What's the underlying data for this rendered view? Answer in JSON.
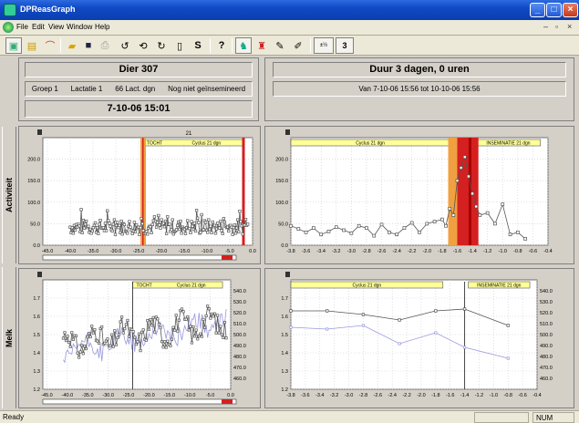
{
  "window": {
    "title": "DPReasGraph"
  },
  "menu": {
    "items": [
      "File",
      "Edit",
      "View",
      "Window",
      "Help"
    ]
  },
  "header": {
    "animal": "Dier 307",
    "info": [
      "Groep 1",
      "Lactatie 1",
      "66 Lact. dgn",
      "Nog niet geïnsemineerd"
    ],
    "datetime": "7-10-06 15:01",
    "duration": "Duur 3 dagen, 0 uren",
    "range": "Van 7-10-06 15:56 tot 10-10-06 15:56"
  },
  "rows": {
    "activity": "Activiteit",
    "milk": "Melk"
  },
  "toolbar": {
    "number_label": "3"
  },
  "status": {
    "left": "Ready",
    "num": "NUM"
  },
  "colors": {
    "series_dark": "#555555",
    "series_light": "#9999dd",
    "event_red": "#d42020",
    "event_orange": "#f0a040",
    "band_yellow": "#ffff99"
  },
  "chart_data": [
    {
      "type": "line",
      "name": "activity-long",
      "xlim": [
        -46,
        0
      ],
      "ylim": [
        0,
        250
      ],
      "xticks": [
        -45,
        -40,
        -35,
        -30,
        -25,
        -20,
        -15,
        -10,
        -5,
        0
      ],
      "xtick_labels": [
        "-45.0",
        "-40.0",
        "-35.0",
        "-30.0",
        "-25.0",
        "-20.0",
        "-15.0",
        "-10.0",
        "-5.0",
        "0.0"
      ],
      "yticks": [
        0,
        50,
        100,
        150,
        200
      ],
      "ytick_labels": [
        "0.0",
        "50.0",
        "100.0",
        "150.0",
        "200.0"
      ],
      "top_label": "21",
      "markers": [
        -24,
        -2
      ],
      "bands": [
        {
          "from": -24,
          "to": -2,
          "labels": [
            "TOCHT",
            "Cyclus 21 dgn"
          ]
        }
      ]
    },
    {
      "type": "line",
      "name": "activity-short",
      "xlim": [
        -3.8,
        -0.4
      ],
      "ylim": [
        0,
        250
      ],
      "xticks": [
        -3.8,
        -3.6,
        -3.4,
        -3.2,
        -3.0,
        -2.8,
        -2.6,
        -2.4,
        -2.2,
        -2.0,
        -1.8,
        -1.6,
        -1.4,
        -1.2,
        -1.0,
        -0.8,
        -0.6,
        -0.4
      ],
      "xtick_labels": [
        "-3.8",
        "-3.6",
        "-3.4",
        "-3.2",
        "-3.0",
        "-2.8",
        "-2.6",
        "-2.4",
        "-2.2",
        "-2.0",
        "-1.8",
        "-1.6",
        "-1.4",
        "-1.2",
        "-1.0",
        "-0.8",
        "-0.6",
        "-0.4"
      ],
      "yticks": [
        0,
        50,
        100,
        150,
        200
      ],
      "ytick_labels": [
        "0.0",
        "50.0",
        "100.0",
        "150.0",
        "200.0"
      ],
      "bands": [
        {
          "from": -3.8,
          "to": -1.7,
          "labels": [
            "Cyclus 21 dgn"
          ]
        },
        {
          "from": -1.35,
          "to": -0.5,
          "labels": [
            "INSEMINATIE 21 dgn"
          ]
        }
      ],
      "series": [
        {
          "x": [
            -3.8,
            -3.7,
            -3.6,
            -3.5,
            -3.4,
            -3.3,
            -3.2,
            -3.1,
            -3.0,
            -2.9,
            -2.8,
            -2.7,
            -2.6,
            -2.5,
            -2.4,
            -2.3,
            -2.2,
            -2.1,
            -2.0,
            -1.9,
            -1.8,
            -1.75,
            -1.7,
            -1.65,
            -1.6,
            -1.55,
            -1.5,
            -1.45,
            -1.4,
            -1.35,
            -1.3,
            -1.2,
            -1.1,
            -1.0,
            -0.9,
            -0.8,
            -0.7
          ],
          "values": [
            45,
            38,
            30,
            40,
            25,
            32,
            42,
            35,
            28,
            45,
            40,
            22,
            48,
            30,
            25,
            40,
            52,
            30,
            50,
            55,
            60,
            45,
            85,
            70,
            150,
            180,
            205,
            160,
            120,
            90,
            70,
            75,
            50,
            95,
            25,
            30,
            15
          ]
        }
      ]
    },
    {
      "type": "line",
      "name": "milk-long",
      "xlim": [
        -46,
        0
      ],
      "ylim": [
        1.2,
        1.8
      ],
      "y2lim": [
        450,
        550
      ],
      "xticks": [
        -45,
        -40,
        -35,
        -30,
        -25,
        -20,
        -15,
        -10,
        -5,
        0
      ],
      "xtick_labels": [
        "-45.0",
        "-40.0",
        "-35.0",
        "-30.0",
        "-25.0",
        "-20.0",
        "-15.0",
        "-10.0",
        "-5.0",
        "0.0"
      ],
      "yticks": [
        1.2,
        1.3,
        1.4,
        1.5,
        1.6,
        1.7
      ],
      "ytick_labels": [
        "1.2",
        "1.3",
        "1.4",
        "1.5",
        "1.6",
        "1.7"
      ],
      "y2ticks": [
        460,
        470,
        480,
        490,
        500,
        510,
        520,
        530,
        540
      ],
      "y2tick_labels": [
        "460.0",
        "470.0",
        "480.0",
        "490.0",
        "500.0",
        "510.0",
        "520.0",
        "530.0",
        "540.0"
      ],
      "markers": [
        -24
      ],
      "bands": [
        {
          "from": -24,
          "to": -2,
          "labels": [
            "TOCHT",
            "Cyclus 21 dgn"
          ]
        }
      ]
    },
    {
      "type": "line",
      "name": "milk-short",
      "xlim": [
        -3.8,
        -0.4
      ],
      "ylim": [
        1.2,
        1.8
      ],
      "y2lim": [
        450,
        550
      ],
      "xticks": [
        -3.8,
        -3.6,
        -3.4,
        -3.2,
        -3.0,
        -2.8,
        -2.6,
        -2.4,
        -2.2,
        -2.0,
        -1.8,
        -1.6,
        -1.4,
        -1.2,
        -1.0,
        -0.8,
        -0.6,
        -0.4
      ],
      "xtick_labels": [
        "-3.8",
        "-3.6",
        "-3.4",
        "-3.2",
        "-3.0",
        "-2.8",
        "-2.6",
        "-2.4",
        "-2.2",
        "-2.0",
        "-1.8",
        "-1.6",
        "-1.4",
        "-1.2",
        "-1.0",
        "-0.8",
        "-0.6",
        "-0.4"
      ],
      "yticks": [
        1.2,
        1.3,
        1.4,
        1.5,
        1.6,
        1.7
      ],
      "ytick_labels": [
        "1.2",
        "1.3",
        "1.4",
        "1.5",
        "1.6",
        "1.7"
      ],
      "y2ticks": [
        460,
        470,
        480,
        490,
        500,
        510,
        520,
        530,
        540
      ],
      "y2tick_labels": [
        "460.0",
        "470.0",
        "480.0",
        "490.0",
        "500.0",
        "510.0",
        "520.0",
        "530.0",
        "540.0"
      ],
      "markers": [
        -1.4
      ],
      "bands": [
        {
          "from": -3.8,
          "to": -1.7,
          "labels": [
            "Cyclus 21 dgn"
          ]
        },
        {
          "from": -1.35,
          "to": -0.5,
          "labels": [
            "INSEMINATIE 21 dgn"
          ]
        }
      ],
      "series": [
        {
          "x": [
            -3.8,
            -3.3,
            -2.8,
            -2.3,
            -1.8,
            -1.4,
            -0.8
          ],
          "values": [
            1.63,
            1.63,
            1.61,
            1.58,
            1.63,
            1.64,
            1.55
          ]
        },
        {
          "x": [
            -3.8,
            -3.3,
            -2.8,
            -2.3,
            -1.8,
            -1.4,
            -0.8
          ],
          "values": [
            1.54,
            1.53,
            1.55,
            1.45,
            1.51,
            1.43,
            1.37
          ]
        }
      ]
    }
  ]
}
